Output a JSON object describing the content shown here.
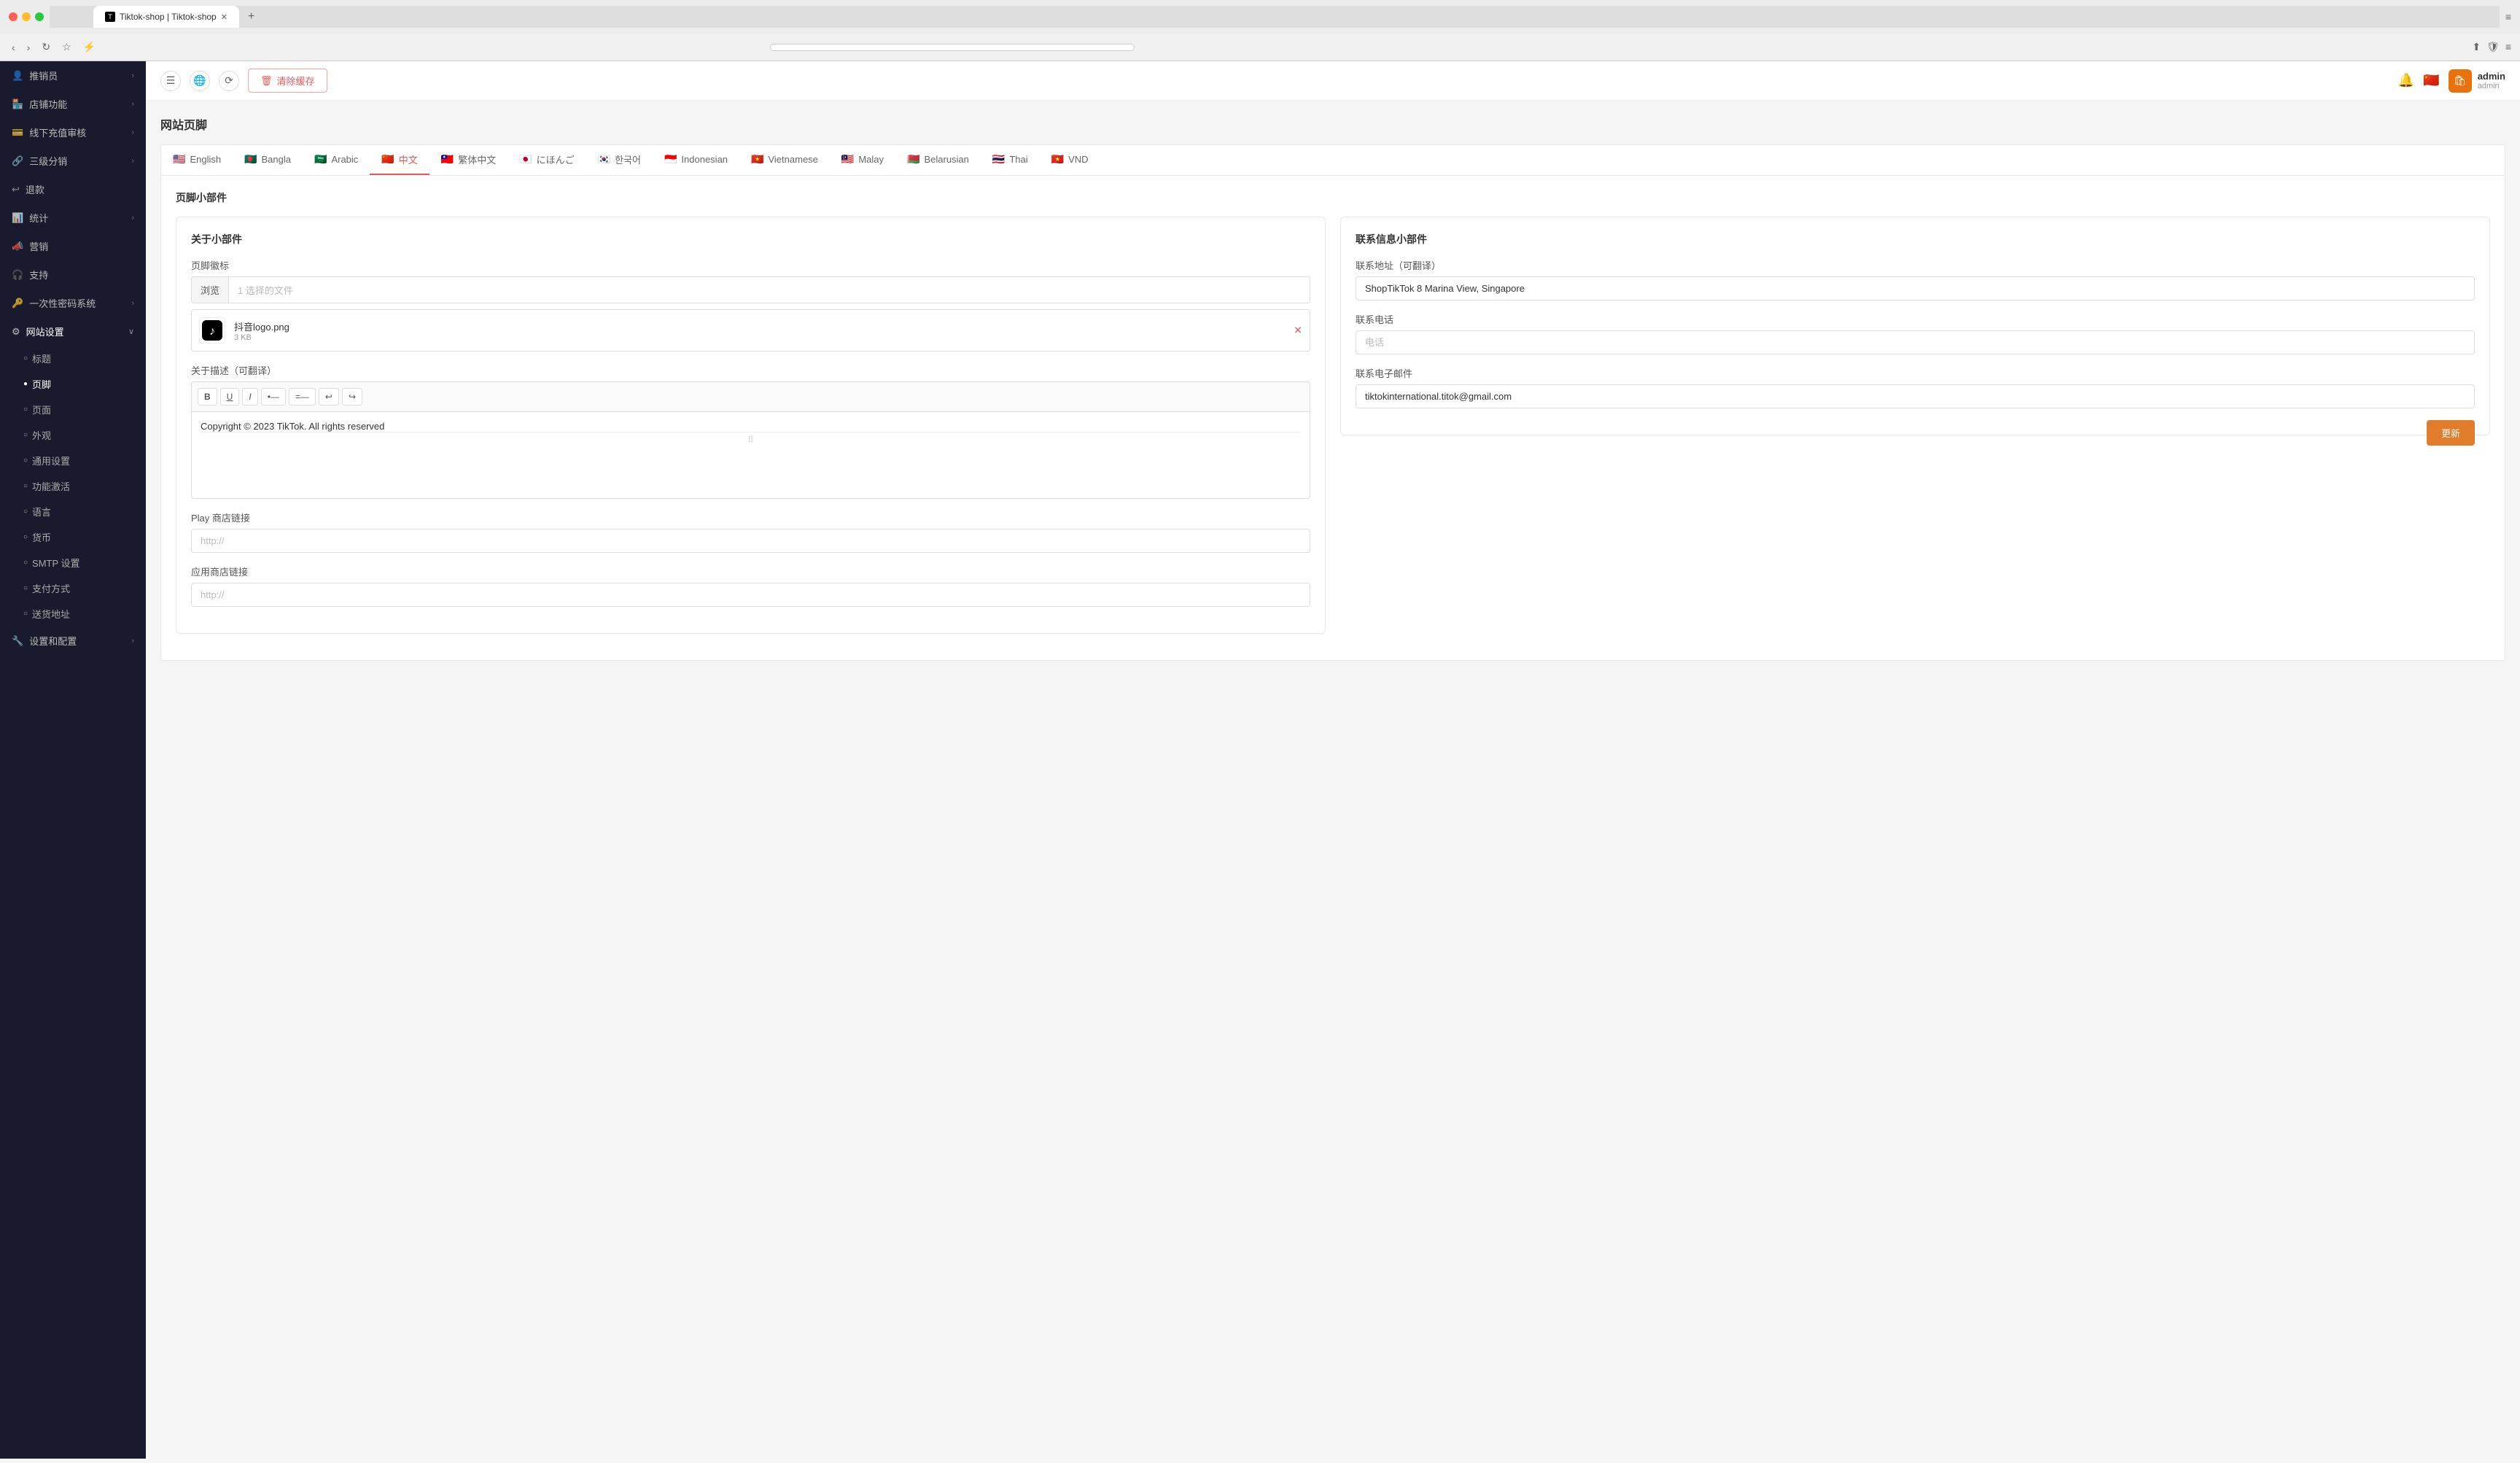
{
  "browser": {
    "tab_title": "Tiktok-shop | Tiktok-shop",
    "tab_icon": "T",
    "address": ""
  },
  "topbar": {
    "clear_cache_label": "清除缓存",
    "notification_label": "notifications",
    "user_name": "admin",
    "user_role": "admin"
  },
  "sidebar": {
    "items": [
      {
        "id": "promoters",
        "icon": "👤",
        "label": "推销员",
        "has_arrow": true
      },
      {
        "id": "shop-features",
        "icon": "🏪",
        "label": "店铺功能",
        "has_arrow": true
      },
      {
        "id": "offline-recharge",
        "icon": "💳",
        "label": "线下充值审核",
        "has_arrow": true
      },
      {
        "id": "three-level",
        "icon": "🔗",
        "label": "三级分销",
        "has_arrow": true
      },
      {
        "id": "refund",
        "icon": "↩",
        "label": "退款",
        "has_arrow": false
      },
      {
        "id": "statistics",
        "icon": "📊",
        "label": "统计",
        "has_arrow": true
      },
      {
        "id": "marketing",
        "icon": "📣",
        "label": "营销",
        "has_arrow": false
      },
      {
        "id": "support",
        "icon": "🎧",
        "label": "支持",
        "has_arrow": false
      },
      {
        "id": "otp",
        "icon": "🔑",
        "label": "一次性密码系统",
        "has_arrow": true
      },
      {
        "id": "website-settings",
        "icon": "⚙",
        "label": "网站设置",
        "has_arrow": true,
        "active": true,
        "sub_items": [
          {
            "id": "theme",
            "label": "标题"
          },
          {
            "id": "footer",
            "label": "页脚",
            "active": true
          },
          {
            "id": "pages",
            "label": "页面"
          },
          {
            "id": "appearance",
            "label": "外观"
          },
          {
            "id": "general",
            "label": "通用设置"
          },
          {
            "id": "feature-activate",
            "label": "功能激活"
          },
          {
            "id": "language",
            "label": "语言"
          },
          {
            "id": "currency",
            "label": "货币"
          },
          {
            "id": "smtp",
            "label": "SMTP 设置"
          },
          {
            "id": "payment",
            "label": "支付方式"
          },
          {
            "id": "shipping",
            "label": "送货地址"
          }
        ]
      },
      {
        "id": "settings-config",
        "icon": "🔧",
        "label": "设置和配置",
        "has_arrow": true
      }
    ]
  },
  "page": {
    "title": "网站页脚",
    "section_title": "页脚小部件"
  },
  "language_tabs": [
    {
      "id": "english",
      "flag": "🇺🇸",
      "label": "English",
      "active": false
    },
    {
      "id": "bangla",
      "flag": "🇧🇩",
      "label": "Bangla",
      "active": false
    },
    {
      "id": "arabic",
      "flag": "🇸🇦",
      "label": "Arabic",
      "active": false
    },
    {
      "id": "chinese",
      "flag": "🇨🇳",
      "label": "中文",
      "active": true
    },
    {
      "id": "traditional-chinese",
      "flag": "🇹🇼",
      "label": "繁体中文",
      "active": false
    },
    {
      "id": "japanese",
      "flag": "🇯🇵",
      "label": "にほんご",
      "active": false
    },
    {
      "id": "korean",
      "flag": "🇰🇷",
      "label": "한국어",
      "active": false
    },
    {
      "id": "indonesian",
      "flag": "🇮🇩",
      "label": "Indonesian",
      "active": false
    },
    {
      "id": "vietnamese",
      "flag": "🇻🇳",
      "label": "Vietnamese",
      "active": false
    },
    {
      "id": "malay",
      "flag": "🇲🇾",
      "label": "Malay",
      "active": false
    },
    {
      "id": "belarusian",
      "flag": "🇧🇾",
      "label": "Belarusian",
      "active": false
    },
    {
      "id": "thai",
      "flag": "🇹🇭",
      "label": "Thai",
      "active": false
    },
    {
      "id": "vnd",
      "flag": "🇻🇳",
      "label": "VND",
      "active": false
    }
  ],
  "about_widget": {
    "title": "关于小部件",
    "logo_label": "页脚徽标",
    "browse_btn": "浏览",
    "file_placeholder": "1 选择的文件",
    "file_name": "抖音logo.png",
    "file_size": "3 KB",
    "description_label": "关于描述（可翻译）",
    "editor_buttons": [
      "B",
      "I",
      "U",
      "•—",
      "=—",
      "↩",
      "↪"
    ],
    "editor_content": "Copyright © 2023 TikTok. All rights reserved",
    "play_store_label": "Play 商店链接",
    "play_store_placeholder": "http://",
    "app_store_label": "应用商店链接",
    "app_store_placeholder": "http://"
  },
  "contact_widget": {
    "title": "联系信息小部件",
    "address_label": "联系地址（可翻译）",
    "address_value": "ShopTikTok 8 Marina View, Singapore",
    "phone_label": "联系电话",
    "phone_placeholder": "电话",
    "email_label": "联系电子邮件",
    "email_value": "tiktokinternational.titok@gmail.com",
    "update_btn": "更新"
  },
  "icons": {
    "menu_icon": "☰",
    "globe_icon": "🌐",
    "cache_icon": "🗑",
    "bell_icon": "🔔",
    "arrow_right": "›"
  }
}
